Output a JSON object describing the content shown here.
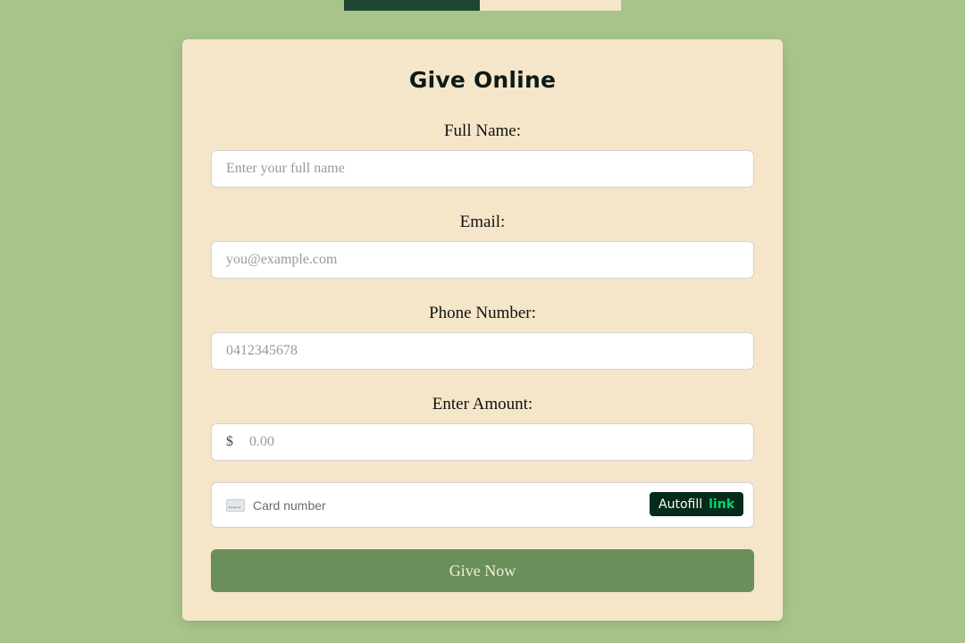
{
  "form": {
    "title": "Give Online",
    "full_name": {
      "label": "Full Name:",
      "placeholder": "Enter your full name",
      "value": ""
    },
    "email": {
      "label": "Email:",
      "placeholder": "you@example.com",
      "value": ""
    },
    "phone": {
      "label": "Phone Number:",
      "placeholder": "0412345678",
      "value": ""
    },
    "amount": {
      "label": "Enter Amount:",
      "currency_symbol": "$",
      "placeholder": "0.00",
      "value": ""
    },
    "card": {
      "placeholder": "Card number",
      "icon": "credit-card-icon"
    },
    "autofill": {
      "label": "Autofill",
      "brand": "link"
    },
    "submit_label": "Give Now"
  },
  "colors": {
    "page_background": "#a7c58a",
    "card_background": "#f5e6c9",
    "tab_dark": "#1f4631",
    "button": "#6a8f5a",
    "autofill_background": "#052b1a",
    "link_green": "#00d66f"
  }
}
